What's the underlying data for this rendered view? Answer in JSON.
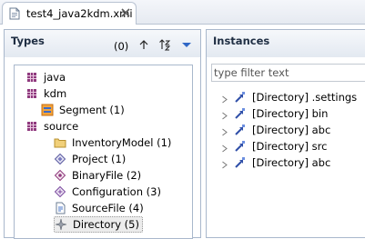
{
  "tab": {
    "title": "test4_java2kdm.xmi"
  },
  "types_panel": {
    "title": "Types",
    "count": "(0)",
    "tree": [
      {
        "label": "java"
      },
      {
        "label": "kdm"
      },
      {
        "label": "Segment (1)"
      },
      {
        "label": "source"
      },
      {
        "label": "InventoryModel (1)"
      },
      {
        "label": "Project (1)"
      },
      {
        "label": "BinaryFile (2)"
      },
      {
        "label": "Configuration (3)"
      },
      {
        "label": "SourceFile (4)"
      },
      {
        "label": "Directory (5)"
      }
    ]
  },
  "instances_panel": {
    "title": "Instances",
    "filter_placeholder": "type filter text",
    "items": [
      {
        "label": "[Directory] .settings"
      },
      {
        "label": "[Directory] bin"
      },
      {
        "label": "[Directory] abc"
      },
      {
        "label": "[Directory] src"
      },
      {
        "label": "[Directory] abc"
      }
    ]
  },
  "colors": {
    "package": "#8f3a7e",
    "selection": "#ececec",
    "header_text": "#1f2e43"
  }
}
